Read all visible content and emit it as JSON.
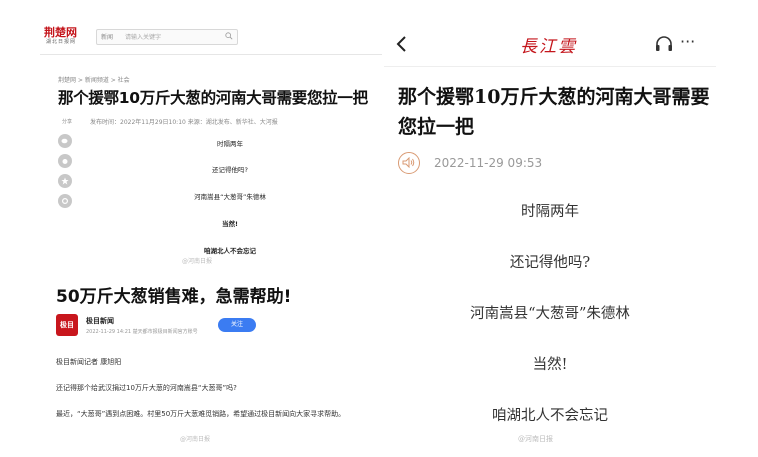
{
  "left_top": {
    "logo": {
      "main": "荆楚网",
      "sub": "湖北日报网"
    },
    "search": {
      "category": "新闻",
      "placeholder": "请输入关键字"
    },
    "breadcrumb": "荆楚网 > 新闻频道 > 社会",
    "title": "那个援鄂10万斤大葱的河南大哥需要您拉一把",
    "share_label": "分享",
    "meta": "发布时间：2022年11月29日10:10    来源：湖北发布、新华社、大河报",
    "body_lines": [
      "时隔两年",
      "还记得他吗?",
      "河南嵩县“大葱哥”朱德林",
      "当然!",
      "咱湖北人不会忘记"
    ],
    "watermark": "@河南日报"
  },
  "left_bottom": {
    "title": "50万斤大葱销售难，急需帮助!",
    "avatar_text": "极目",
    "source_name": "极目新闻",
    "source_meta": "2022-11-29 14:21    楚天都市报极目新闻官方账号",
    "follow_label": "关注",
    "paragraphs": [
      "极目新闻记者 康旭阳",
      "还记得那个给武汉捐过10万斤大葱的河南嵩县“大葱哥”吗?",
      "最近，“大葱哥”遇到点困难。村里50万斤大葱难觅销路，希望通过极目新闻向大家寻求帮助。"
    ],
    "watermark": "@河南日报"
  },
  "right": {
    "logo": "長江雲",
    "more": "···",
    "title": "那个援鄂10万斤大葱的河南大哥需要您拉一把",
    "date": "2022-11-29  09:53",
    "body_lines": [
      "时隔两年",
      "还记得他吗?",
      "河南嵩县“大葱哥”朱德林",
      "当然!",
      "咱湖北人不会忘记"
    ],
    "watermark": "@河南日报"
  },
  "colors": {
    "brand_red": "#c4161c",
    "follow_blue": "#3b7cf2",
    "speaker_ring": "#d99a73"
  }
}
